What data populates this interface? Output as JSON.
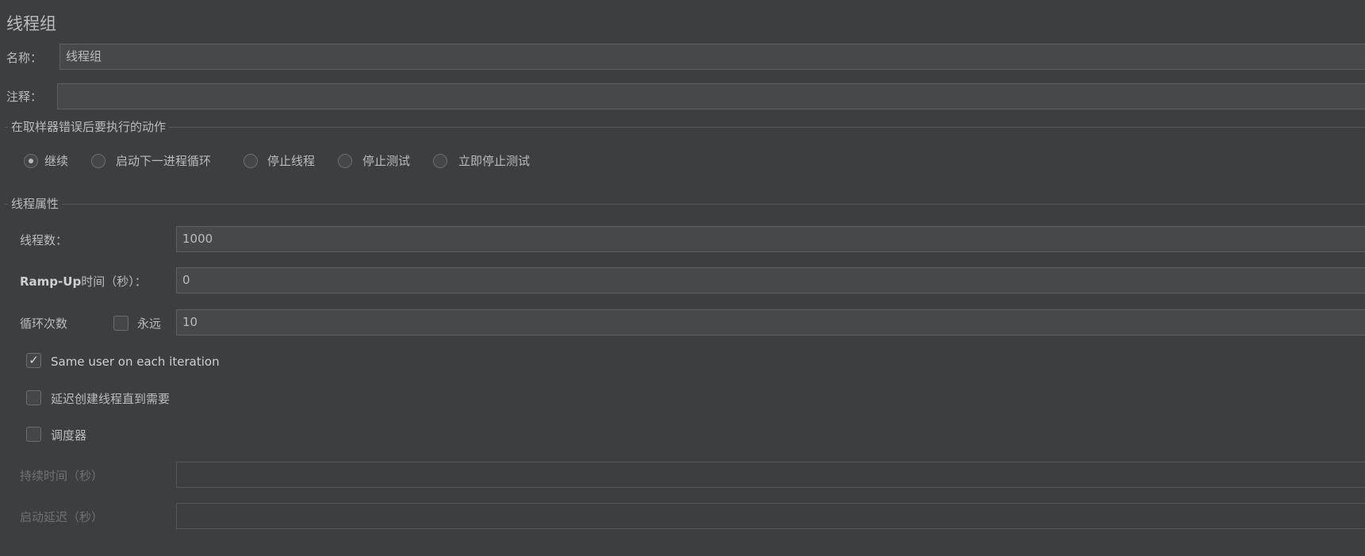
{
  "title": "线程组",
  "name": {
    "label": "名称：",
    "value": "线程组"
  },
  "comment": {
    "label": "注释：",
    "value": ""
  },
  "error_action": {
    "section_title": "在取样器错误后要执行的动作",
    "options": [
      {
        "label": "继续",
        "selected": true
      },
      {
        "label": "启动下一进程循环",
        "selected": false
      },
      {
        "label": "停止线程",
        "selected": false
      },
      {
        "label": "停止测试",
        "selected": false
      },
      {
        "label": "立即停止测试",
        "selected": false
      }
    ]
  },
  "thread_props": {
    "section_title": "线程属性",
    "threads": {
      "label": "线程数：",
      "value": "1000"
    },
    "rampup": {
      "label_bold": "Ramp-Up",
      "label": "时间（秒）：",
      "value": "0"
    },
    "loop": {
      "label": "循环次数",
      "forever_label": "永远",
      "forever_checked": false,
      "value": "10"
    },
    "same_user": {
      "label": "Same user on each iteration",
      "checked": true
    },
    "delay_create": {
      "label": "延迟创建线程直到需要",
      "checked": false
    },
    "scheduler": {
      "label": "调度器",
      "checked": false
    },
    "duration": {
      "label": "持续时间（秒）",
      "value": ""
    },
    "startup_delay": {
      "label": "启动延迟（秒）",
      "value": ""
    }
  },
  "colors": {
    "background": "#3c3f41",
    "input_bg": "#45494a",
    "border": "#5e6060",
    "text": "#bbbbbb"
  }
}
